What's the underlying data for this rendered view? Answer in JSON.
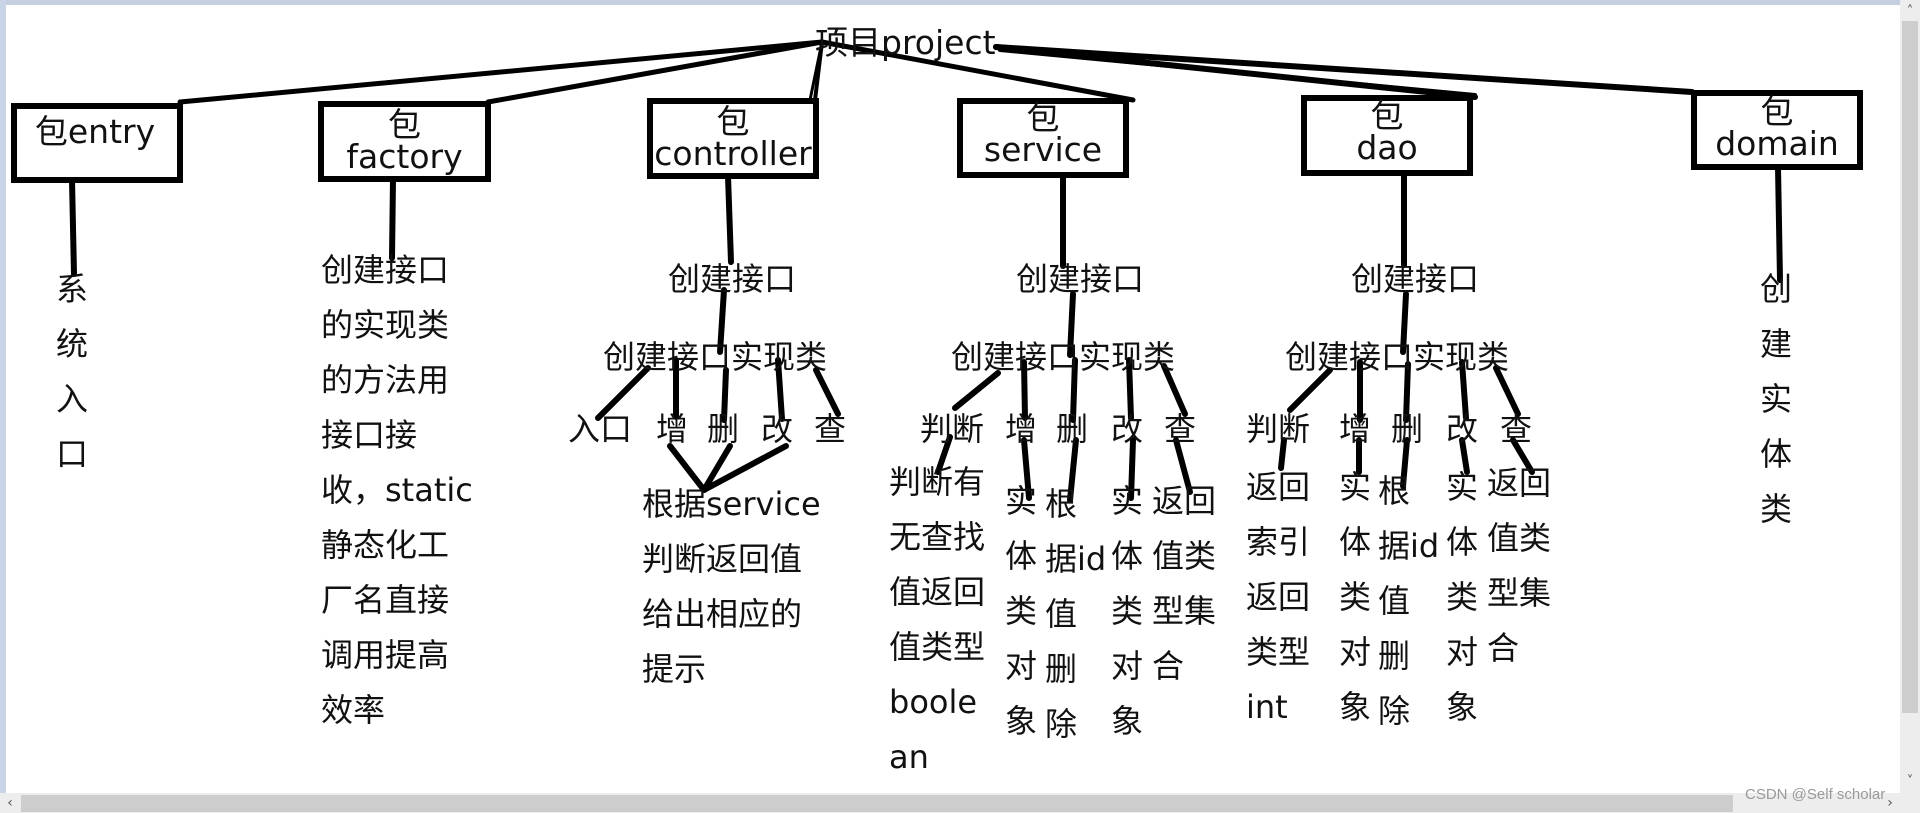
{
  "root": {
    "label": "项目project"
  },
  "packages": [
    {
      "id": "entry",
      "label_line1": "包entry",
      "label_line2": "",
      "description_vertical": [
        "系",
        "统",
        "入",
        "口"
      ]
    },
    {
      "id": "factory",
      "label_line1": "包",
      "label_line2": "factory",
      "description_lines": [
        "创建接口",
        "的实现类",
        "的方法用",
        "接口接",
        "收，static",
        "静态化工",
        "厂名直接",
        "调用提高",
        "效率"
      ]
    },
    {
      "id": "controller",
      "label_line1": "包",
      "label_line2": "controller",
      "interface": "创建接口",
      "impl": "创建接口实现类",
      "methods": [
        "入口",
        "增",
        "删",
        "改",
        "查"
      ],
      "note_lines": [
        "根据service",
        "判断返回值",
        "给出相应的",
        "提示"
      ]
    },
    {
      "id": "service",
      "label_line1": "包",
      "label_line2": "service",
      "interface": "创建接口",
      "impl": "创建接口实现类",
      "methods": [
        "判断",
        "增",
        "删",
        "改",
        "查"
      ],
      "details": [
        [
          "判断有",
          "无查找",
          "值返回",
          "值类型",
          "boole",
          "an"
        ],
        [
          "实",
          "体",
          "类",
          "对",
          "象"
        ],
        [
          "根",
          "据id",
          "值",
          "删",
          "除"
        ],
        [
          "实",
          "体",
          "类",
          "对",
          "象"
        ],
        [
          "返回",
          "值类",
          "型集",
          "合"
        ]
      ]
    },
    {
      "id": "dao",
      "label_line1": "包",
      "label_line2": "dao",
      "interface": "创建接口",
      "impl": "创建接口实现类",
      "methods": [
        "判断",
        "增",
        "删",
        "改",
        "查"
      ],
      "details": [
        [
          "返回",
          "索引",
          "返回",
          "类型",
          "int"
        ],
        [
          "实",
          "体",
          "类",
          "对",
          "象"
        ],
        [
          "根",
          "据id",
          "值",
          "删",
          "除"
        ],
        [
          "实",
          "体",
          "类",
          "对",
          "象"
        ],
        [
          "返回",
          "值类",
          "型集",
          "合"
        ]
      ]
    },
    {
      "id": "domain",
      "label_line1": "包",
      "label_line2": "domain",
      "description_vertical": [
        "创",
        "建",
        "实",
        "体",
        "类"
      ]
    }
  ],
  "scrollbars": {
    "up_icon": "˄",
    "down_icon": "˅",
    "left_icon": "‹",
    "right_icon": "›"
  },
  "watermark": "CSDN @Self scholar"
}
